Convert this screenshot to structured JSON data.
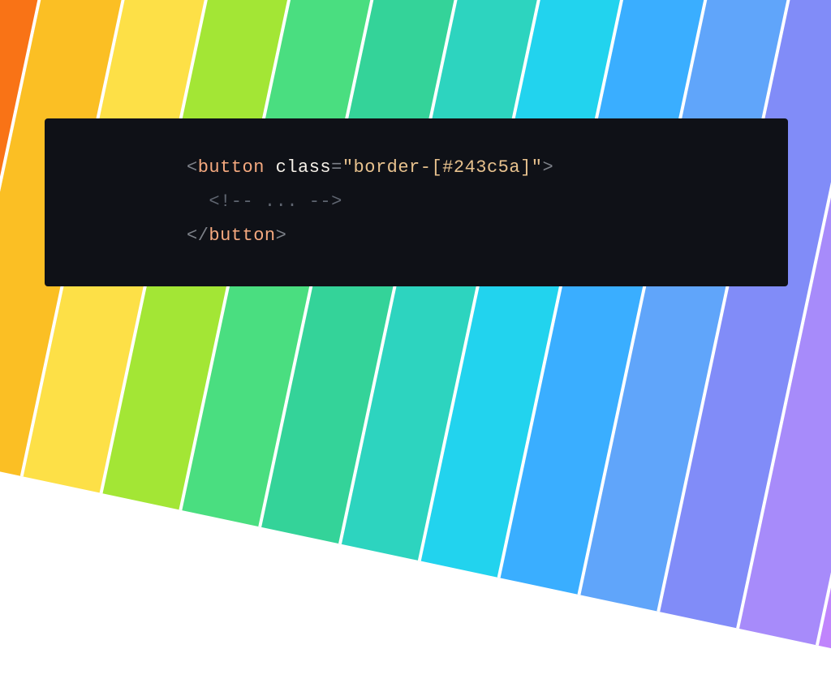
{
  "code": {
    "line1": {
      "bracket_open": "<",
      "tag": "button",
      "space1": " ",
      "attr": "class",
      "equals": "=",
      "string": "\"border-[#243c5a]\"",
      "bracket_close": ">"
    },
    "line2": {
      "indent": "  ",
      "comment_open": "<!--",
      "comment_dots": " ... ",
      "comment_close": "-->"
    },
    "line3": {
      "bracket_open": "</",
      "tag": "button",
      "bracket_close": ">"
    }
  }
}
